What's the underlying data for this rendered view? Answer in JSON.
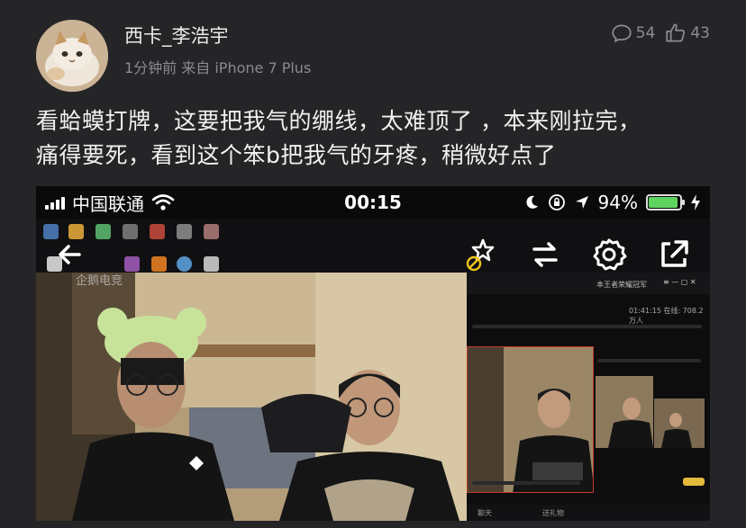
{
  "user": {
    "name": "西卡_李浩宇",
    "meta": "1分钟前 来自 iPhone 7 Plus"
  },
  "stats": {
    "comments": "54",
    "likes": "43"
  },
  "post": {
    "line1": "看蛤蟆打牌，这要把我气的绷线，太难顶了 ，本来刚拉完，",
    "line2": "痛得要死，看到这个笨b把我气的牙疼，稍微好点了"
  },
  "screenshot": {
    "carrier": "中国联通",
    "time": "00:15",
    "battery_percent": "94%",
    "battery_level": 0.94,
    "watermark": "企鹅电竞",
    "side_header": "本王者荣耀冠军",
    "side_online": "01:41:15  在线: 708.2万人",
    "side_footer_left": "聊天",
    "side_footer_right": "送礼物",
    "icons": [
      "back-arrow-icon",
      "wand-off-icon",
      "rotate-icon",
      "gear-icon",
      "external-link-icon"
    ]
  },
  "colors": {
    "background": "#252528",
    "text": "#e9e9ea",
    "muted": "#8a8a90",
    "battery": "#5fd35f"
  }
}
